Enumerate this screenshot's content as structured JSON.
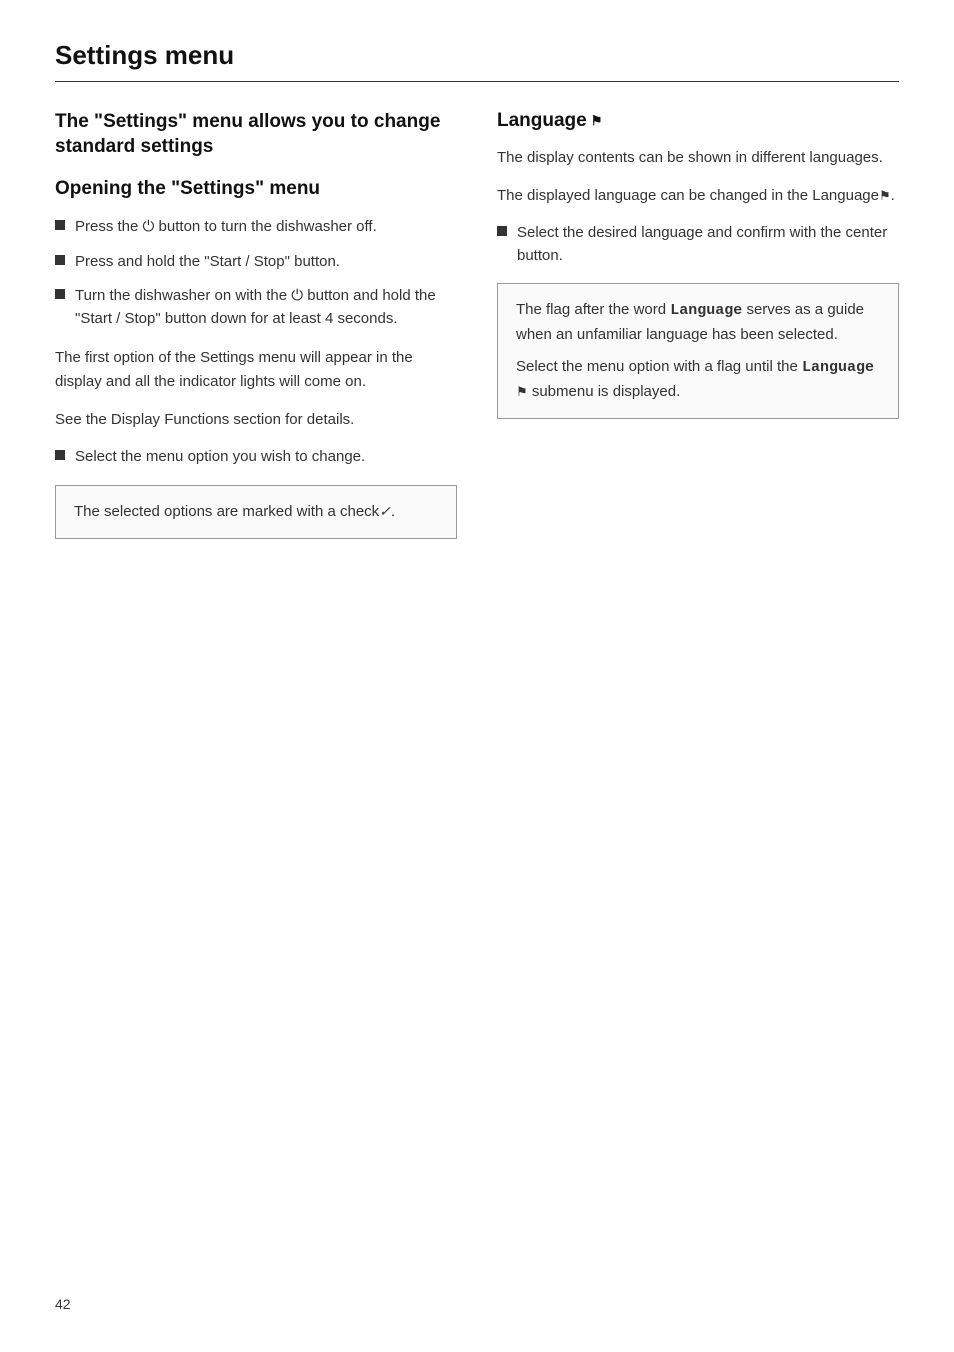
{
  "page": {
    "title": "Settings menu",
    "page_number": "42"
  },
  "left_col": {
    "main_heading": "The \"Settings\" menu allows you to change standard settings",
    "opening_heading": "Opening the \"Settings\" menu",
    "bullets": [
      "Press the ⏻ button to turn the dishwasher off.",
      "Press and hold the \"Start / Stop\" button.",
      "Turn the dishwasher on with the ⏻ button and hold the \"Start / Stop\" button down for at least 4 seconds."
    ],
    "para1": "The first option of the Settings menu will appear in the display and all the indicator lights will come on.",
    "para2": "See the Display Functions section for details.",
    "bullet2": "Select the menu option you wish to change.",
    "info_box": {
      "text_before": "The selected options are marked with a  check",
      "check_symbol": "✓",
      "text_after": "."
    }
  },
  "right_col": {
    "language_heading": "Language",
    "flag_symbol": "⚑",
    "para1": "The display contents can be shown in different languages.",
    "para2_before": "The displayed language can be changed in the Language",
    "para2_flag": "⚑",
    "para2_after": ".",
    "bullet": "Select the desired language and confirm with the center button.",
    "info_box": {
      "line1_before": "The flag after the word",
      "language_bold": "Language",
      "line1_after": "serves as a guide when an unfamiliar language has been selected.",
      "line2_before": "Select the menu option with a flag until the",
      "language_bold2": "Language",
      "flag2": "⚑",
      "line2_after": "submenu is displayed."
    }
  }
}
